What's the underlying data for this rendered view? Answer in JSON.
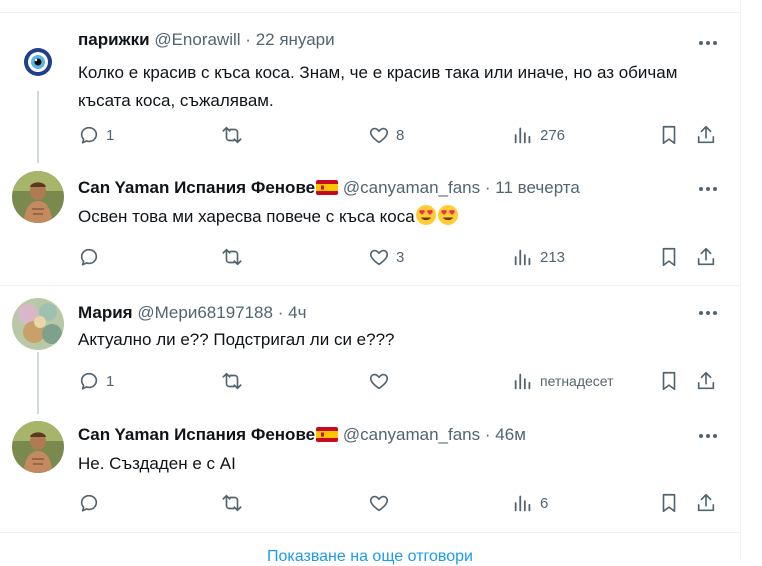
{
  "tweets": [
    {
      "name": "парижки",
      "handle": "@Enorawill",
      "time": "22 януари",
      "text": "Колко е красив с къса коса. Знам, че е красив така или иначе, но аз обичам късата коса, съжалявам.",
      "replies": "1",
      "retweets": "",
      "likes": "8",
      "views": "276",
      "avatar": "evil-eye"
    },
    {
      "name": "Can Yaman Испания Фенове",
      "handle": "@canyaman_fans",
      "time": "11 вечерта",
      "text": "Освен това ми харесва повече с къса коса",
      "replies": "",
      "retweets": "",
      "likes": "3",
      "views": "213",
      "avatar": "portrait"
    },
    {
      "name": "Мария",
      "handle": "@Мери68197188",
      "time": "4ч",
      "text": "Актуално ли е?? Подстригал ли си е???",
      "replies": "1",
      "retweets": "",
      "likes": "",
      "views": "петнадесет",
      "avatar": "painting"
    },
    {
      "name": "Can Yaman Испания Фенове",
      "handle": "@canyaman_fans",
      "time": "46м",
      "text": "Не. Създаден е с AI",
      "replies": "",
      "retweets": "",
      "likes": "",
      "views": "6",
      "avatar": "portrait"
    }
  ],
  "separator": "·",
  "show_more": "Показване на още отговори",
  "colors": {
    "text": "#0f1419",
    "secondary": "#536471",
    "accent": "#1d9bf0",
    "line": "#cfd9de"
  }
}
